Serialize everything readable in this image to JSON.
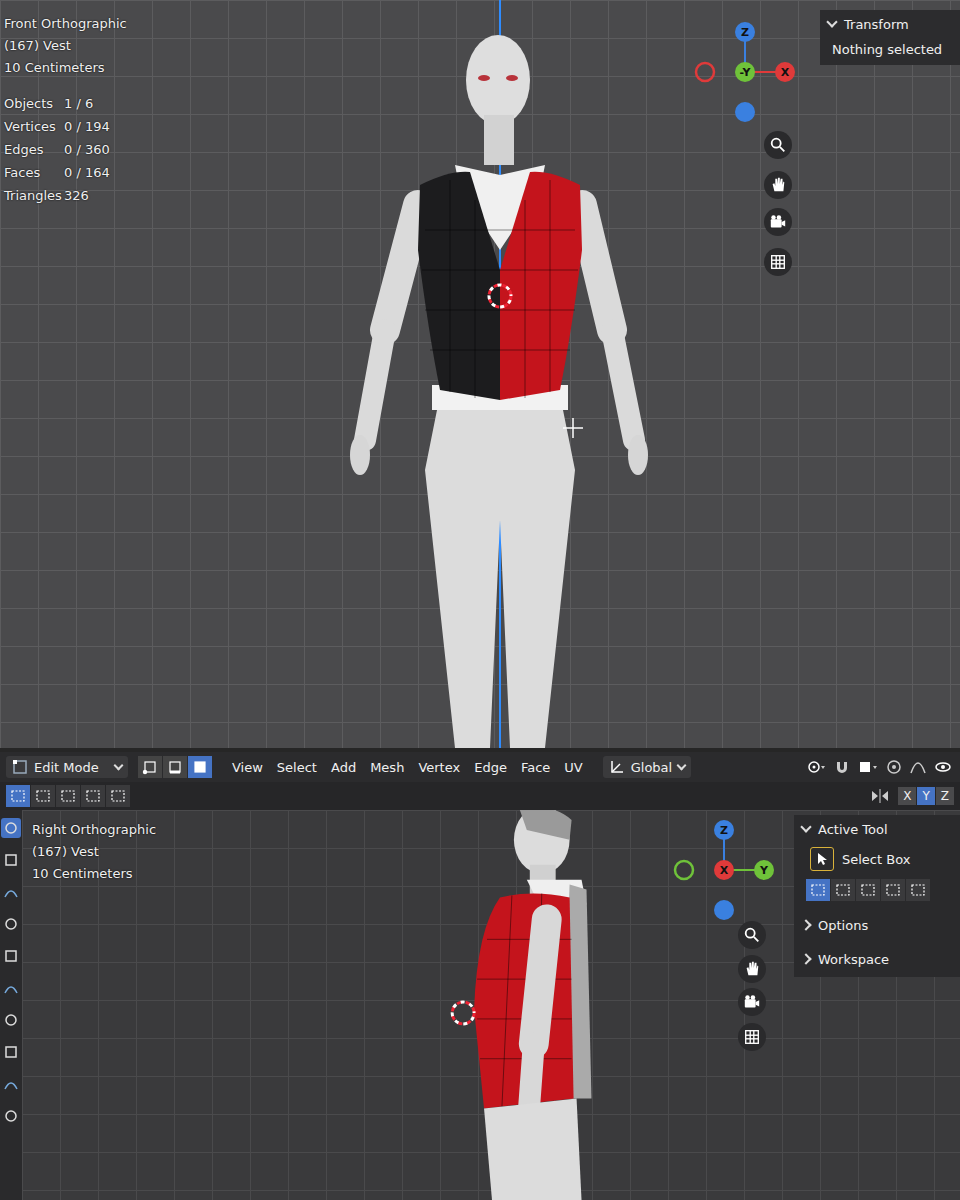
{
  "top_viewport": {
    "view": "Front Orthographic",
    "object": "(167) Vest",
    "scale": "10 Centimeters",
    "stats": [
      {
        "label": "Objects",
        "value": "1 / 6"
      },
      {
        "label": "Vertices",
        "value": "0 / 194"
      },
      {
        "label": "Edges",
        "value": "0 / 360"
      },
      {
        "label": "Faces",
        "value": "0 / 164"
      },
      {
        "label": "Triangles",
        "value": "326"
      }
    ],
    "gizmo": {
      "top": "Z",
      "center": "-Y",
      "right": "X"
    },
    "panel": {
      "title": "Transform",
      "text": "Nothing selected"
    }
  },
  "header": {
    "mode": "Edit Mode",
    "menus": [
      "View",
      "Select",
      "Add",
      "Mesh",
      "Vertex",
      "Edge",
      "Face",
      "UV"
    ],
    "orientation": "Global"
  },
  "select_modes": [
    {
      "kind": "vertex",
      "selected": false
    },
    {
      "kind": "edge",
      "selected": false
    },
    {
      "kind": "face",
      "selected": true
    }
  ],
  "box_modes": [
    {
      "selected": true
    },
    {
      "selected": false
    },
    {
      "selected": false
    },
    {
      "selected": false
    },
    {
      "selected": false
    }
  ],
  "mirror_axes": [
    {
      "label": "X",
      "selected": false
    },
    {
      "label": "Y",
      "selected": true
    },
    {
      "label": "Z",
      "selected": false
    }
  ],
  "bottom_viewport": {
    "view": "Right Orthographic",
    "object": "(167) Vest",
    "scale": "10 Centimeters",
    "gizmo": {
      "top": "Z",
      "center": "X",
      "right": "Y"
    },
    "panel": {
      "title": "Active Tool",
      "tool": "Select Box",
      "sections": [
        {
          "label": "Options",
          "expanded": false
        },
        {
          "label": "Workspace",
          "expanded": false
        }
      ]
    }
  }
}
